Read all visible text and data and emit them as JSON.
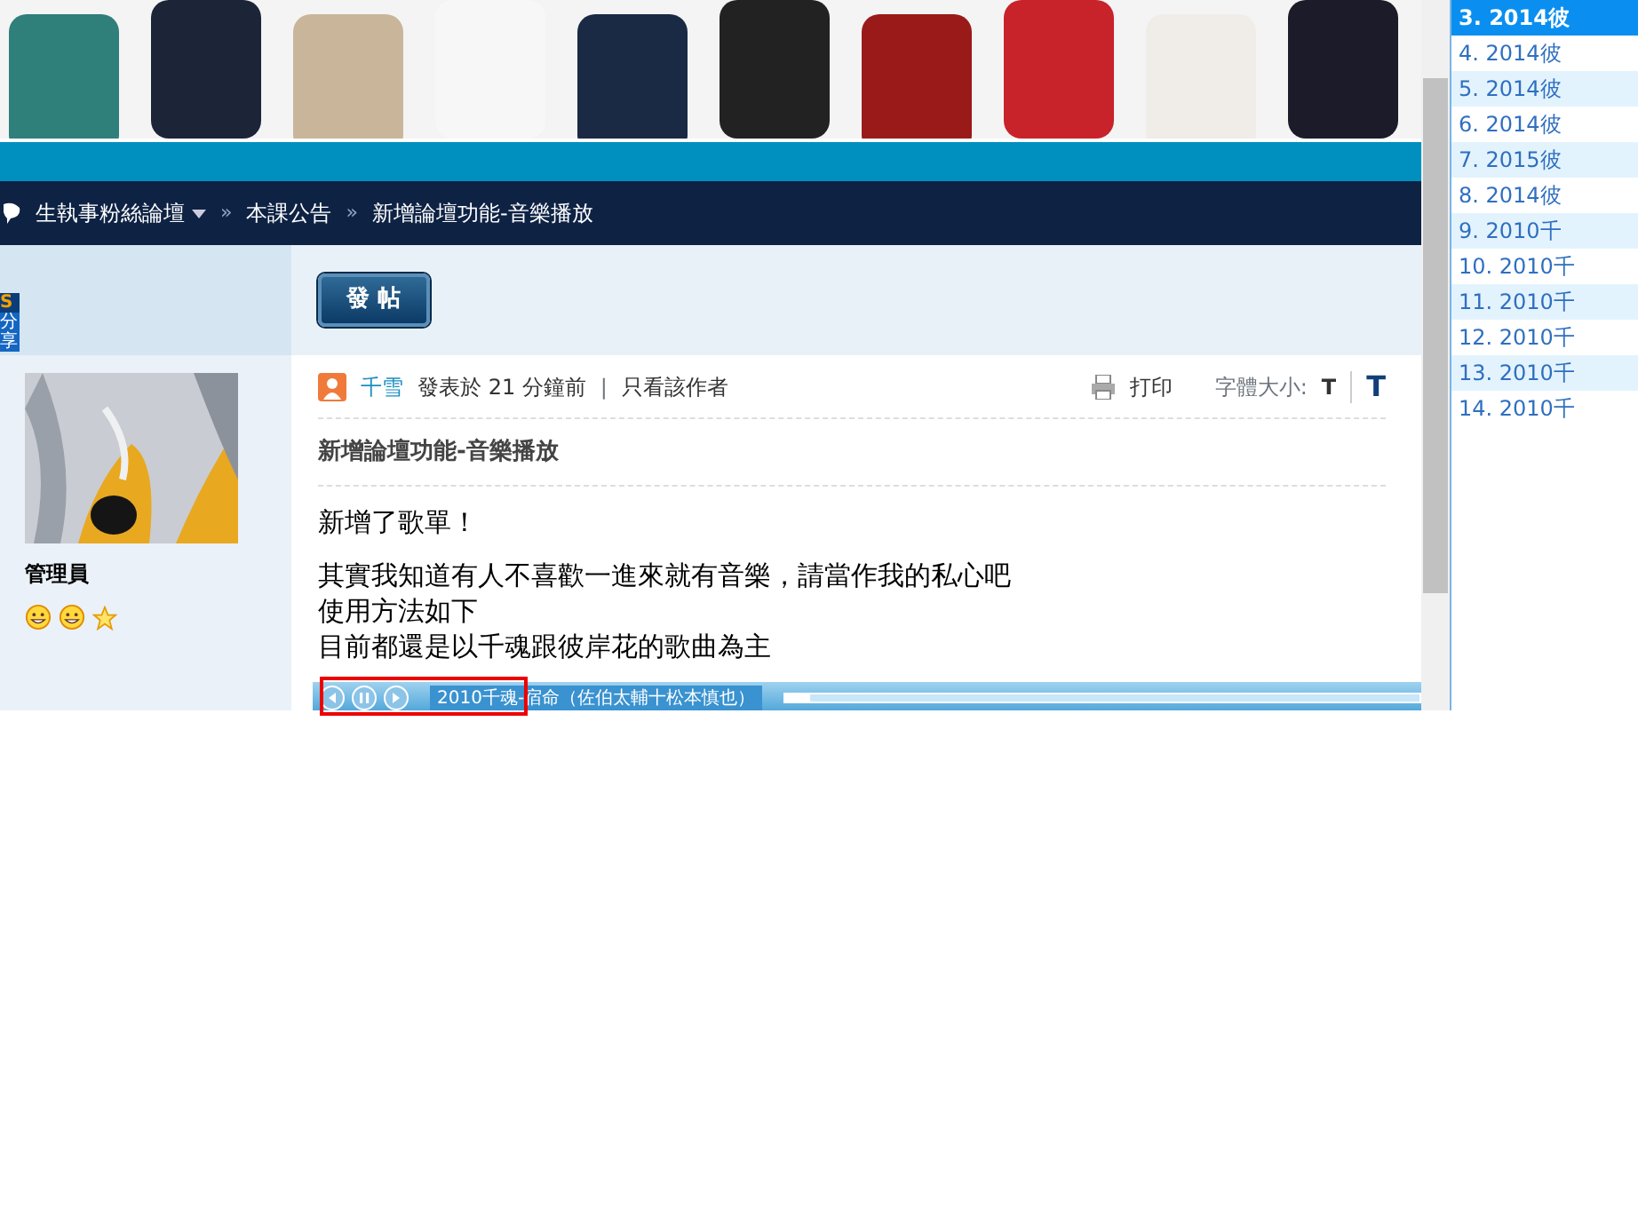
{
  "breadcrumb": {
    "separator": "»",
    "items": [
      {
        "text": "生執事粉絲論壇",
        "dropdown": true
      },
      {
        "text": "本課公告",
        "dropdown": false
      },
      {
        "text": "新增論壇功能-音樂播放",
        "dropdown": false
      }
    ]
  },
  "post_button": "發 帖",
  "share_tab": {
    "logo": "S",
    "label": "分享"
  },
  "author": {
    "rank": "管理員",
    "rank_icons": [
      {
        "kind": "smiley"
      },
      {
        "kind": "smiley"
      },
      {
        "kind": "star"
      }
    ]
  },
  "post": {
    "author": "千雪",
    "posted": "發表於 21 分鐘前",
    "separator": "|",
    "only_author": "只看該作者",
    "print": "打印",
    "font_size_label": "字體大小:",
    "font_small": "T",
    "font_large": "T",
    "title": "新增論壇功能-音樂播放",
    "paragraphs": [
      [
        "新增了歌單！"
      ],
      [
        "其實我知道有人不喜歡一進來就有音樂，請當作我的私心吧",
        "使用方法如下",
        "目前都還是以千魂跟彼岸花的歌曲為主"
      ]
    ]
  },
  "player": {
    "track": "2010千魂-宿命（佐伯太輔十松本慎也）",
    "level": 0.04
  },
  "playlist": [
    {
      "text": "3. 2014彼",
      "selected": true
    },
    {
      "text": "4. 2014彼",
      "selected": false
    },
    {
      "text": "5. 2014彼",
      "selected": false
    },
    {
      "text": "6. 2014彼",
      "selected": false
    },
    {
      "text": "7. 2015彼",
      "selected": false
    },
    {
      "text": "8. 2014彼",
      "selected": false
    },
    {
      "text": "9. 2010千",
      "selected": false
    },
    {
      "text": "10. 2010千",
      "selected": false
    },
    {
      "text": "11. 2010千",
      "selected": false
    },
    {
      "text": "12. 2010千",
      "selected": false
    },
    {
      "text": "13. 2010千",
      "selected": false
    },
    {
      "text": "14. 2010千",
      "selected": false
    }
  ]
}
